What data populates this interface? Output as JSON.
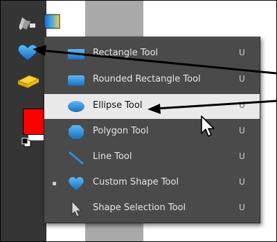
{
  "menu": {
    "items": [
      {
        "label": "Rectangle Tool",
        "shortcut": "U",
        "icon": "rectangle-icon",
        "selected": false,
        "current": false
      },
      {
        "label": "Rounded Rectangle Tool",
        "shortcut": "U",
        "icon": "rounded-rectangle-icon",
        "selected": false,
        "current": false
      },
      {
        "label": "Ellipse Tool",
        "shortcut": "U",
        "icon": "ellipse-icon",
        "selected": true,
        "current": false
      },
      {
        "label": "Polygon Tool",
        "shortcut": "U",
        "icon": "polygon-icon",
        "selected": false,
        "current": false
      },
      {
        "label": "Line Tool",
        "shortcut": "U",
        "icon": "line-icon",
        "selected": false,
        "current": false
      },
      {
        "label": "Custom Shape Tool",
        "shortcut": "U",
        "icon": "custom-shape-icon",
        "selected": false,
        "current": true
      },
      {
        "label": "Shape Selection Tool",
        "shortcut": "U",
        "icon": "shape-selection-icon",
        "selected": false,
        "current": false
      }
    ]
  },
  "toolbar": {
    "icons": [
      "paint-bucket-icon",
      "gradient-icon",
      "custom-shape-heart-icon",
      "eraser-icon"
    ]
  },
  "colors": {
    "foreground_swatch": "#ff0000",
    "background_swatch": "#ffffff",
    "toolbar_bg": "#353535",
    "menu_bg": "#4a4a4a",
    "menu_highlight": "#e9e9e9",
    "shape_blue": "#2e8fd8"
  }
}
